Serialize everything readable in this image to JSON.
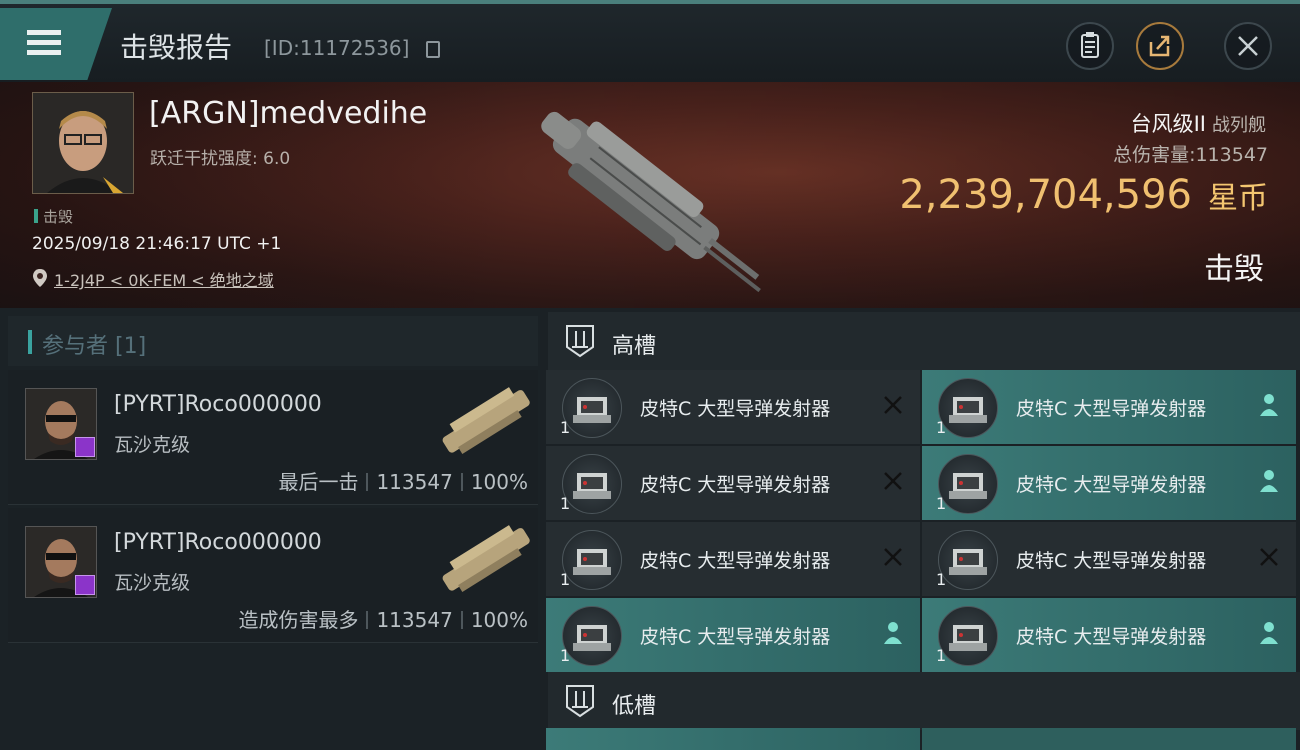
{
  "header": {
    "title": "击毁报告",
    "id_text": "[ID:11172536]",
    "icons": [
      "menu-icon",
      "clipboard-icon",
      "share-icon",
      "close-icon"
    ]
  },
  "victim": {
    "name": "[ARGN]medvedihe",
    "warp_text": "跃迁干扰强度: 6.0",
    "status": "击毁",
    "datetime": "2025/09/18 21:46:17 UTC +1",
    "location": "1-2J4P < 0K-FEM < 绝地之域",
    "ship_name": "台风级II",
    "ship_class": "战列舰",
    "damage_label": "总伤害量:",
    "damage_value": "113547",
    "isk_value": "2,239,704,596",
    "isk_unit": "星币",
    "result": "击毁"
  },
  "participants": {
    "header": "参与者 [1]",
    "rows": [
      {
        "name": "[PYRT]Roco000000",
        "ship": "瓦沙克级",
        "role": "最后一击",
        "damage": "113547",
        "percent": "100%"
      },
      {
        "name": "[PYRT]Roco000000",
        "ship": "瓦沙克级",
        "role": "造成伤害最多",
        "damage": "113547",
        "percent": "100%"
      }
    ]
  },
  "fitting": {
    "high_label": "高槽",
    "low_label": "低槽",
    "high_modules": [
      {
        "name": "皮特C 大型导弹发射器",
        "qty": "1",
        "status": "destroyed"
      },
      {
        "name": "皮特C 大型导弹发射器",
        "qty": "1",
        "status": "dropped"
      },
      {
        "name": "皮特C 大型导弹发射器",
        "qty": "1",
        "status": "destroyed"
      },
      {
        "name": "皮特C 大型导弹发射器",
        "qty": "1",
        "status": "dropped"
      },
      {
        "name": "皮特C 大型导弹发射器",
        "qty": "1",
        "status": "destroyed"
      },
      {
        "name": "皮特C 大型导弹发射器",
        "qty": "1",
        "status": "destroyed"
      },
      {
        "name": "皮特C 大型导弹发射器",
        "qty": "1",
        "status": "dropped"
      },
      {
        "name": "皮特C 大型导弹发射器",
        "qty": "1",
        "status": "dropped"
      }
    ],
    "colors": {
      "accent": "#3aa3a0",
      "isk": "#f0c070",
      "dropped_bg": "#3c7b78",
      "destroyed_bg": "#262d31"
    }
  }
}
